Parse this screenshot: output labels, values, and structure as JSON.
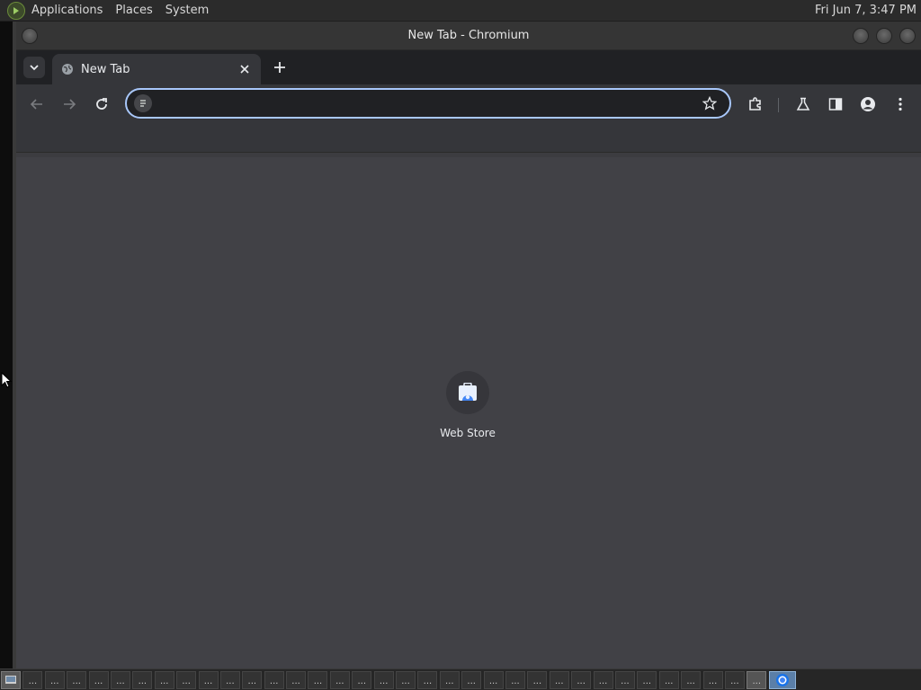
{
  "top_panel": {
    "menus": [
      "Applications",
      "Places",
      "System"
    ],
    "clock": "Fri Jun  7,  3:47 PM"
  },
  "window": {
    "title": "New Tab - Chromium"
  },
  "tabs": [
    {
      "title": "New Tab",
      "active": true
    }
  ],
  "omnibox": {
    "value": "",
    "placeholder": ""
  },
  "shortcuts": [
    {
      "label": "Web Store",
      "icon": "web-store-icon"
    }
  ],
  "taskbar": {
    "task_label": "...",
    "task_count": 34,
    "active_task_label": "..."
  },
  "colors": {
    "accent": "#a8c7fa",
    "tab_bg": "#35363a",
    "content_bg": "#414146"
  }
}
